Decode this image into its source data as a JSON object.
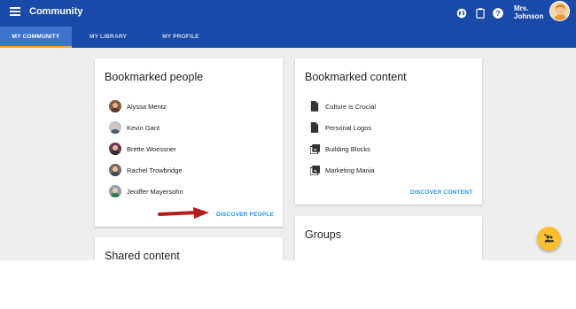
{
  "header": {
    "app_title": "Community",
    "user_name_line1": "Mrs.",
    "user_name_line2": "Johnson",
    "icons": [
      "menu-icon",
      "globe-icon",
      "clipboard-icon",
      "help-icon"
    ]
  },
  "tabs": [
    {
      "label": "MY COMMUNITY",
      "active": true
    },
    {
      "label": "MY LIBRARY",
      "active": false
    },
    {
      "label": "MY PROFILE",
      "active": false
    }
  ],
  "bookmarked_people": {
    "title": "Bookmarked people",
    "people": [
      {
        "name": "Alyssa Mentz"
      },
      {
        "name": "Kevin Gant"
      },
      {
        "name": "Brette Woessner"
      },
      {
        "name": "Rachel Trowbridge"
      },
      {
        "name": "Jeniffer Mayersohn"
      }
    ],
    "action": "DISCOVER PEOPLE"
  },
  "bookmarked_content": {
    "title": "Bookmarked content",
    "items": [
      {
        "name": "Culture is Crucial",
        "icon": "document-icon"
      },
      {
        "name": "Personal Logos",
        "icon": "document-icon"
      },
      {
        "name": "Building Blocks",
        "icon": "image-collection-icon"
      },
      {
        "name": "Marketing Mania",
        "icon": "image-collection-icon"
      }
    ],
    "action": "DISCOVER CONTENT"
  },
  "shared_content": {
    "title": "Shared content"
  },
  "groups": {
    "title": "Groups"
  },
  "colors": {
    "header": "#1a4aa8",
    "tab_active": "#3e73cc",
    "accent": "#f5a623",
    "link": "#2196f3",
    "fab": "#fbc02d",
    "arrow": "#b71c1c"
  }
}
